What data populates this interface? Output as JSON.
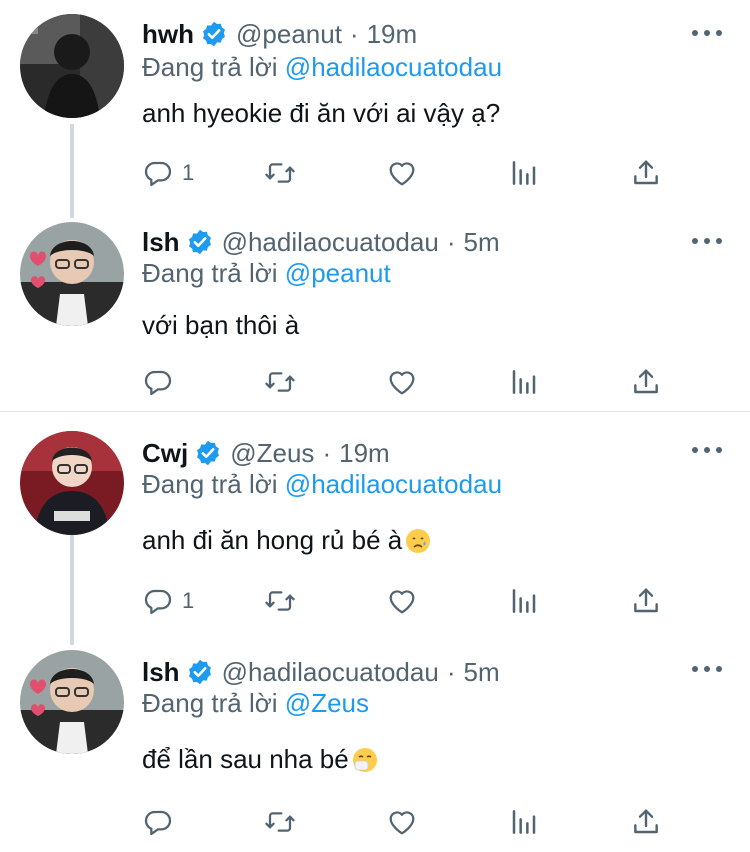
{
  "tweets": [
    {
      "name": "hwh",
      "handle": "@peanut",
      "dot": "·",
      "time": "19m",
      "reply_prefix": "Đang trả lời",
      "reply_to": "@hadilaocuatodau",
      "text": "anh hyeokie đi ăn với ai vậy ạ?",
      "reply_count": "1"
    },
    {
      "name": "lsh",
      "handle": "@hadilaocuatodau",
      "dot": "·",
      "time": "5m",
      "reply_prefix": "Đang trả lời",
      "reply_to": "@peanut",
      "text": "với bạn thôi à",
      "reply_count": ""
    },
    {
      "name": "Cwj",
      "handle": "@Zeus",
      "dot": "·",
      "time": "19m",
      "reply_prefix": "Đang trả lời",
      "reply_to": "@hadilaocuatodau",
      "text": "anh đi ăn hong rủ bé à",
      "emoji": "crying-face",
      "reply_count": "1"
    },
    {
      "name": "lsh",
      "handle": "@hadilaocuatodau",
      "dot": "·",
      "time": "5m",
      "reply_prefix": "Đang trả lời",
      "reply_to": "@Zeus",
      "text": "để lần sau nha bé",
      "emoji": "sneezing-face",
      "reply_count": ""
    }
  ],
  "colors": {
    "accent": "#1d9bf0",
    "muted": "#536471",
    "text": "#0f1419",
    "thread_line": "#cfd9de"
  },
  "icons": [
    "reply-icon",
    "retweet-icon",
    "like-icon",
    "analytics-icon",
    "share-icon",
    "more-icon",
    "verified-badge-icon"
  ]
}
